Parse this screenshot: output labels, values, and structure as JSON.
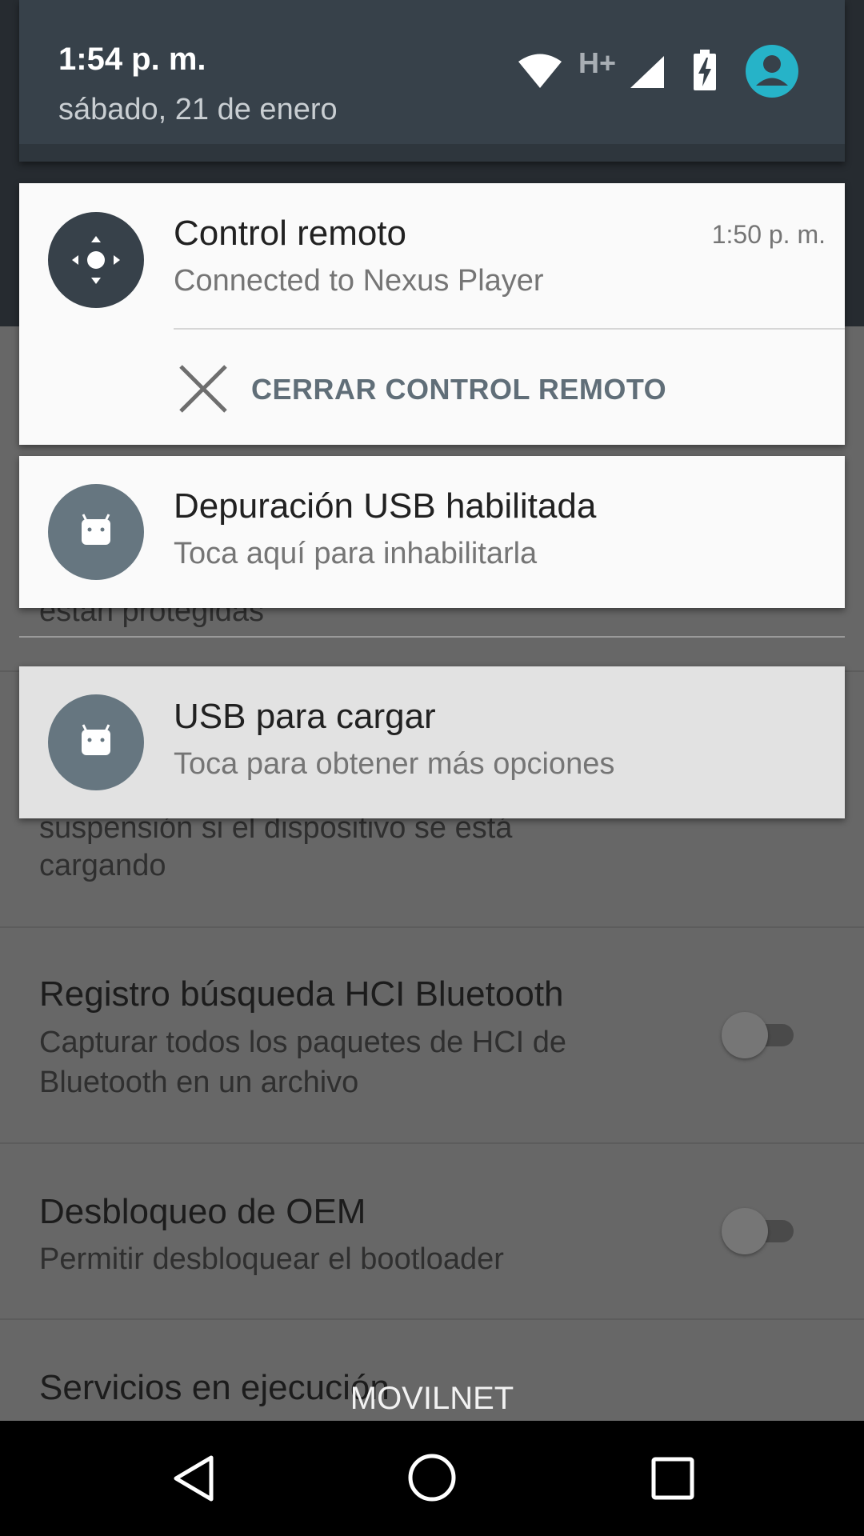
{
  "status_bar": {
    "time": "1:54 p. m.",
    "date": "sábado, 21 de enero",
    "network_type": "H+",
    "icons": [
      "wifi-icon",
      "signal-icon",
      "battery-charging-icon",
      "user-icon"
    ],
    "accent_color": "#26b3c8"
  },
  "notifications": [
    {
      "title": "Control remoto",
      "text": "Connected to Nexus Player",
      "time": "1:50 p. m.",
      "icon": "remote-dpad-icon",
      "icon_bg": "#37414a",
      "action": {
        "icon": "close-icon",
        "label": "CERRAR CONTROL REMOTO"
      }
    },
    {
      "title": "Depuración USB habilitada",
      "text": "Toca aquí para inhabilitarla",
      "icon": "android-icon",
      "icon_bg": "#667680"
    },
    {
      "title": "USB para cargar",
      "text": "Toca para obtener más opciones",
      "icon": "android-icon",
      "icon_bg": "#667680"
    }
  ],
  "background_settings": {
    "partial_texts": {
      "protected": "están protegidas",
      "stay_awake_line1": "suspensión si el dispositivo se está",
      "stay_awake_line2": "cargando"
    },
    "items": [
      {
        "title": "Registro búsqueda HCI Bluetooth",
        "subtitle_line1": "Capturar todos los paquetes de HCI de",
        "subtitle_line2": "Bluetooth en un archivo",
        "enabled": false
      },
      {
        "title": "Desbloqueo de OEM",
        "subtitle_line1": "Permitir desbloquear el bootloader",
        "enabled": false
      },
      {
        "title": "Servicios en ejecución"
      }
    ]
  },
  "carrier": "MOVILNET",
  "nav_bar": {
    "buttons": [
      "back-icon",
      "home-icon",
      "recents-icon"
    ]
  }
}
